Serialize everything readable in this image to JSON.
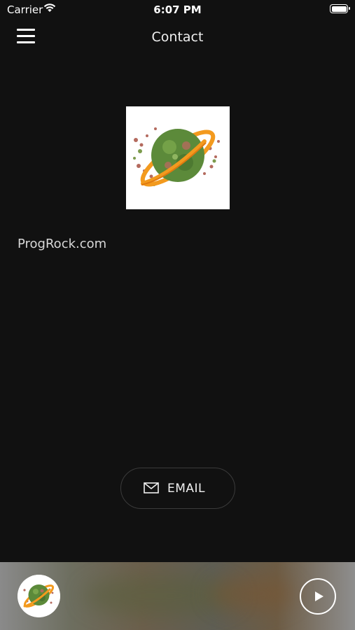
{
  "status_bar": {
    "carrier": "Carrier",
    "time": "6:07 PM"
  },
  "nav": {
    "title": "Contact",
    "menu_icon": "hamburger-menu-icon"
  },
  "logo": {
    "icon": "planet-logo"
  },
  "website": "ProgRock.com",
  "email_button": {
    "label": "EMAIL",
    "icon": "mail-icon"
  },
  "player": {
    "play_icon": "play-icon",
    "artwork_icon": "planet-logo"
  },
  "colors": {
    "background": "#111111",
    "ring_orange": "#f39a1e",
    "planet_green": "#5c8a3a"
  }
}
